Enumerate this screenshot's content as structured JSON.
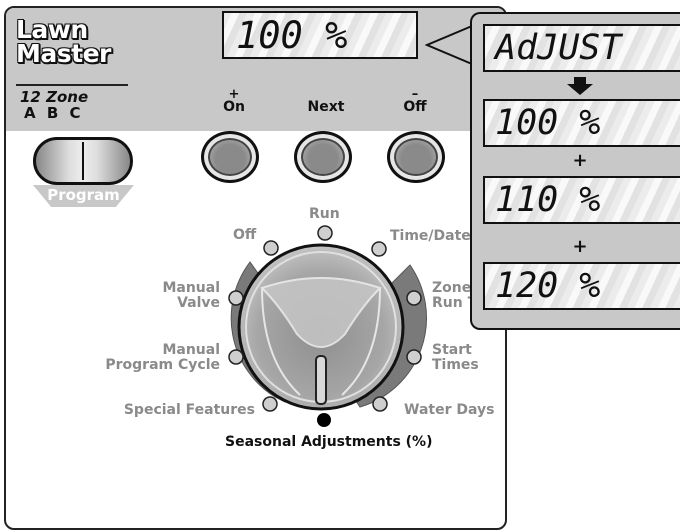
{
  "brand": {
    "line1": "Lawn",
    "line2": "Master",
    "model": "12 Zone",
    "programs": "A B C"
  },
  "display": {
    "value": "100 %"
  },
  "buttons": [
    {
      "sign": "+",
      "label": "On"
    },
    {
      "sign": "",
      "label": "Next"
    },
    {
      "sign": "–",
      "label": "Off"
    }
  ],
  "program_button": {
    "label": "Program"
  },
  "dial": {
    "positions": {
      "off": "Off",
      "run": "Run",
      "time_date": "Time/Date",
      "manual_valve": "Manual\nValve",
      "zone_run_time": "Zone\nRun Time",
      "manual_program_cycle": "Manual\nProgram Cycle",
      "start_times": "Start\nTimes",
      "special_features": "Special Features",
      "water_days": "Water Days",
      "seasonal_adjustments": "Seasonal Adjustments (%)"
    },
    "selected": "seasonal_adjustments"
  },
  "callout": {
    "screens": [
      "AdJUST",
      "100 %",
      "110 %",
      "120 %"
    ],
    "separators": [
      "arrow-down-icon",
      "+",
      "+"
    ]
  }
}
